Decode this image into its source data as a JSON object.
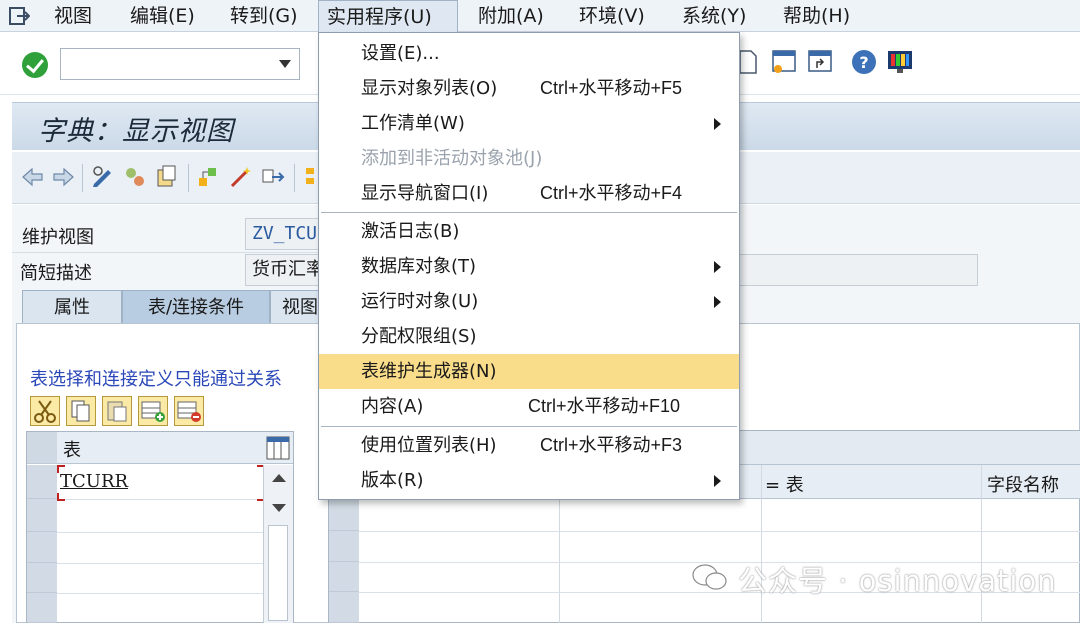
{
  "menubar": {
    "items": [
      {
        "label": "视图"
      },
      {
        "label": "编辑(E)"
      },
      {
        "label": "转到(G)"
      },
      {
        "label": "实用程序(U)"
      },
      {
        "label": "附加(A)"
      },
      {
        "label": "环境(V)"
      },
      {
        "label": "系统(Y)"
      },
      {
        "label": "帮助(H)"
      }
    ],
    "active": "实用程序(U)"
  },
  "toolbar": {
    "command_value": ""
  },
  "title": "字典：显示视图",
  "form": {
    "view_label": "维护视图",
    "view_value": "ZV_TCU",
    "desc_label": "简短描述",
    "desc_value": "货币汇率"
  },
  "tabs": [
    {
      "label": "属性"
    },
    {
      "label": "表/连接条件"
    },
    {
      "label": "视图"
    }
  ],
  "info_text": "表选择和连接定义只能通过关系",
  "left_table": {
    "header": "表",
    "rows": [
      "TCURR"
    ]
  },
  "right_table": {
    "columns": [
      "= 表",
      "字段名称"
    ]
  },
  "dropdown": {
    "items": [
      {
        "label": "设置(E)...",
        "shortcut": "",
        "submenu": false,
        "disabled": false
      },
      {
        "label": "显示对象列表(O)",
        "shortcut": "Ctrl+水平移动+F5",
        "submenu": false,
        "disabled": false
      },
      {
        "label": "工作清单(W)",
        "shortcut": "",
        "submenu": true,
        "disabled": false
      },
      {
        "label": "添加到非活动对象池(J)",
        "shortcut": "",
        "submenu": false,
        "disabled": true
      },
      {
        "label": "显示导航窗口(I)",
        "shortcut": "Ctrl+水平移动+F4",
        "submenu": false,
        "disabled": false
      },
      {
        "label": "激活日志(B)",
        "shortcut": "",
        "submenu": false,
        "disabled": false
      },
      {
        "label": "数据库对象(T)",
        "shortcut": "",
        "submenu": true,
        "disabled": false
      },
      {
        "label": "运行时对象(U)",
        "shortcut": "",
        "submenu": true,
        "disabled": false
      },
      {
        "label": "分配权限组(S)",
        "shortcut": "",
        "submenu": false,
        "disabled": false
      },
      {
        "label": "表维护生成器(N)",
        "shortcut": "",
        "submenu": false,
        "disabled": false,
        "highlighted": true
      },
      {
        "label": "内容(A)",
        "shortcut": "Ctrl+水平移动+F10",
        "submenu": false,
        "disabled": false
      },
      {
        "label": "使用位置列表(H)",
        "shortcut": "Ctrl+水平移动+F3",
        "submenu": false,
        "disabled": false
      },
      {
        "label": "版本(R)",
        "shortcut": "",
        "submenu": true,
        "disabled": false
      }
    ]
  },
  "watermark": "公众号 · osinnovation",
  "colors": {
    "highlight": "#f9dd8b",
    "info_text": "#2b48b8",
    "title_bar": "#cbd9e8"
  }
}
